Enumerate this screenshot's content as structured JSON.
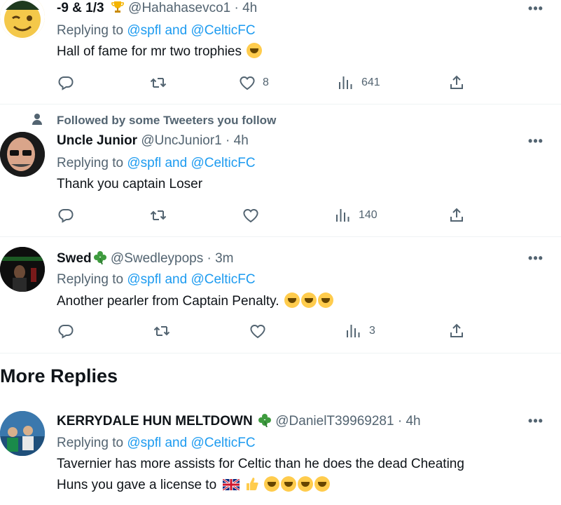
{
  "tweets": [
    {
      "name": "-9 & 1/3",
      "handle": "@Hahahasevco1 · 4h",
      "replying_prefix": "Replying to",
      "replying_to": "@spfl and @CelticFC",
      "text": "Hall of fame for mr two trophies",
      "likes": "8",
      "views": "641"
    },
    {
      "social": "Followed by some Tweeters you follow",
      "name": "Uncle Junior",
      "handle": "@UncJunior1 · 4h",
      "replying_prefix": "Replying to",
      "replying_to": "@spfl and @CelticFC",
      "text": "Thank you captain Loser",
      "views": "140"
    },
    {
      "name": "Swed",
      "handle": "@Swedleypops · 3m",
      "replying_prefix": "Replying to",
      "replying_to": "@spfl and @CelticFC",
      "text": "Another pearler from Captain Penalty.",
      "views": "3"
    }
  ],
  "more_replies": {
    "title": "More Replies",
    "tweet": {
      "name": "KERRYDALE HUN MELTDOWN",
      "handle": "@DanielT39969281 · 4h",
      "replying_prefix": "Replying to",
      "replying_to": "@spfl and @CelticFC",
      "text_line1": "Tavernier has more assists for Celtic than he does the dead Cheating",
      "text_line2": "Huns you gave a license to"
    }
  },
  "more_label": "•••",
  "colors": {
    "link": "#1d9bf0",
    "secondary": "#536471",
    "text": "#0f1419"
  },
  "icons": [
    "reply-icon",
    "retweet-icon",
    "like-icon",
    "views-icon",
    "share-icon",
    "more-icon",
    "person-icon"
  ]
}
